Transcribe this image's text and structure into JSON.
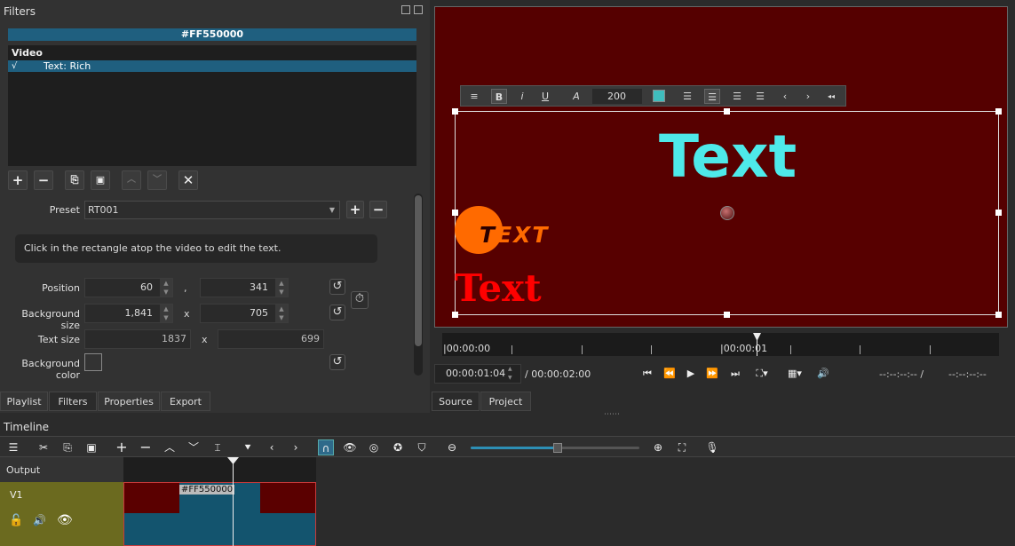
{
  "filters": {
    "title": "Filters",
    "clip_name": "#FF550000",
    "list_header": "Video",
    "list_items": [
      {
        "check": "√",
        "label": "Text: Rich"
      }
    ],
    "preset_label": "Preset",
    "preset_value": "RT001",
    "hint": "Click in the rectangle atop the video to edit the text.",
    "position_label": "Position",
    "position_x": "60",
    "position_y": "341",
    "position_sep": ",",
    "bgsize_label": "Background size",
    "bgsize_w": "1,841",
    "bgsize_h": "705",
    "size_sep": "x",
    "textsize_label": "Text size",
    "textsize_w": "1837",
    "textsize_h": "699",
    "bgcolor_label": "Background color"
  },
  "left_tabs": [
    "Playlist",
    "Filters",
    "Properties",
    "Export"
  ],
  "right_tabs": [
    "Source",
    "Project"
  ],
  "player": {
    "font_size": "200",
    "big_text": "Text",
    "orange_text_first": "T",
    "orange_text_rest": "EXT",
    "red_text": "Text",
    "ruler_start": "|00:00:00",
    "ruler_mid": "|00:00:01",
    "timecode": "00:00:01:04",
    "duration": "/ 00:00:02:00",
    "in_point": "--:--:--:-- /",
    "out_point": "--:--:--:--"
  },
  "timeline": {
    "title": "Timeline",
    "output_label": "Output",
    "track_label": "V1",
    "clip_label": "#FF550000"
  },
  "colors": {
    "accent": "#1f5f7f",
    "video_bg": "#550000",
    "cyan_text": "#4ee9e9",
    "orange": "#ff6a00",
    "red_text": "#ff0000",
    "track_head": "#6b6a1f",
    "clip": "#13546e"
  }
}
